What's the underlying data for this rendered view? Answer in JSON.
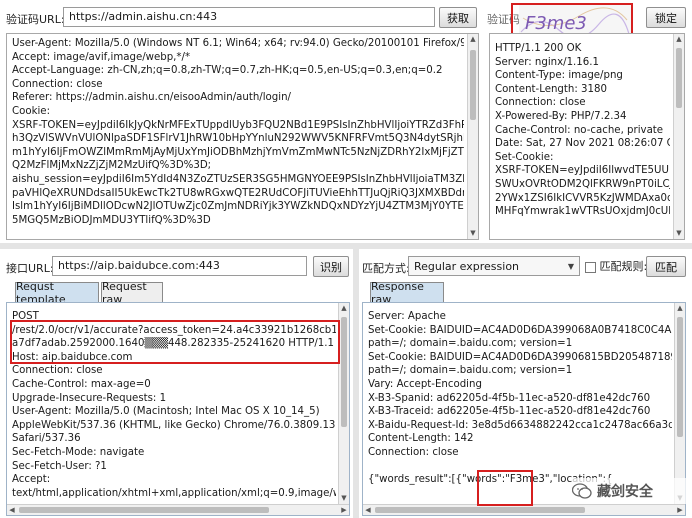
{
  "captcha_url": {
    "label": "验证码URL:",
    "value": "https://admin.aishu.cn:443",
    "fetch_button": "获取"
  },
  "captcha": {
    "label": "验证码",
    "image_text": "F3me3",
    "confirm_button": "锁定"
  },
  "request_top": {
    "lines": [
      "User-Agent: Mozilla/5.0 (Windows NT 6.1; Win64; x64; rv:94.0) Gecko/20100101 Firefox/94.0",
      "Accept: image/avif,image/webp,*/*",
      "Accept-Language: zh-CN,zh;q=0.8,zh-TW;q=0.7,zh-HK;q=0.5,en-US;q=0.3,en;q=0.2",
      "Connection: close",
      "Referer: https://admin.aishu.cn/eisooAdmin/auth/login/",
      "Cookie:",
      "XSRF-TOKEN=eyJpdiI6IkJyQkNrMFExTUppdlUyb3FQU2NBd1E9PSIsInZhbHVlIjoiYTRZd3FhRjd3Qj",
      "h3QzVlSWVnVUlONlpaSDF1SFlrV1JhRW10bHpYYnluN292WWV5KNFRFVmt5Q3N4dytSRjhlMSlsI",
      "m1hYyI6IjFmOWZlMmRmMjAyMjUxYmJiODBhMzhjYmVmZmMwNTc5NzNjZDRhY2IxMjFjZTMyZW",
      "Q2MzFlMjMxNzZjZjM2MzUifQ%3D%3D;",
      "aishu_session=eyJpdiI6Im5YdId4N3ZoZTUzSER3SG5HMGNYOEE9PSIsInZhbHVlIjoiaTM3ZkhOVG",
      "paVHlQeXRUNDdsaII5UkEwcTk2TU8wRGxwQTE2RUdCOFJiTUVieEhhTTJuQjRiQ3JXMXBDdmZNby",
      "Islm1hYyI6IjBiMDllODcwN2JlOTUwZjc0ZmJmNDRiYjk3YWZkNDQxNDYzYjU4ZTM3MjY0YTE2NE2E",
      "5MGQ5MzBiODJmMDU3YTlifQ%3D%3D"
    ]
  },
  "response_top": {
    "lines": [
      "HTTP/1.1 200 OK",
      "Server: nginx/1.16.1",
      "Content-Type: image/png",
      "Content-Length: 3180",
      "Connection: close",
      "X-Powered-By: PHP/7.2.34",
      "Cache-Control: no-cache, private",
      "Date: Sat, 27 Nov 2021 08:26:07 GMT",
      "Set-Cookie:",
      "XSRF-TOKEN=eyJpdiI6IlwvdTE5UU1H",
      "SWUxOVRtODM2QlFKRW9nPT0iLCJ",
      "2YWx1ZSI6IkICVVR5KzJWMDAxa0dr",
      "MHFqYmwrak1wVTRsUOxjdmJ0cUlH"
    ]
  },
  "api_url": {
    "label": "接口URL:",
    "value": "https://aip.baidubce.com:443",
    "identify_button": "识别"
  },
  "match": {
    "label": "匹配方式:",
    "mode": "Regular expression",
    "rule_label": "匹配规则:",
    "match_button": "匹配"
  },
  "request_tabs": {
    "template": "Requst template",
    "raw": "Request raw"
  },
  "request_template": {
    "lines": [
      "POST",
      "/rest/2.0/ocr/v1/accurate?access_token=24.a4c33921b1268cb10440",
      "a7df7adab.2592000.1640▒▒▒448.282335-25241620 HTTP/1.1",
      "Host: aip.baidubce.com",
      "Connection: close",
      "Cache-Control: max-age=0",
      "Upgrade-Insecure-Requests: 1",
      "User-Agent: Mozilla/5.0 (Macintosh; Intel Mac OS X 10_14_5)",
      "AppleWebKit/537.36 (KHTML, like Gecko) Chrome/76.0.3809.132",
      "Safari/537.36",
      "Sec-Fetch-Mode: navigate",
      "Sec-Fetch-User: ?1",
      "Accept:",
      "text/html,application/xhtml+xml,application/xml;q=0.9,image/webp,ima"
    ]
  },
  "response_tabs": {
    "raw": "Response raw"
  },
  "response_raw": {
    "lines": [
      "Server: Apache",
      "Set-Cookie: BAIDUID=AC4AD0D6DA399068A0B7418C0C4A2EBF:F",
      "path=/; domain=.baidu.com; version=1",
      "Set-Cookie: BAIDUID=AC4AD0D6DA39906815BD205487189078:FG",
      "path=/; domain=.baidu.com; version=1",
      "Vary: Accept-Encoding",
      "X-B3-Spanid: ad62205d-4f5b-11ec-a520-df81e42dc760",
      "X-B3-Traceid: ad62205e-4f5b-11ec-a520-df81e42dc760",
      "X-Baidu-Request-Id: 3e8d5d6634882242cca1c2478ac66a3d1000334",
      "Content-Length: 142",
      "Connection: close",
      "",
      "{\"words_result\":[{\"words\":\"F3me3\",\"location\":{"
    ]
  },
  "watermark": {
    "text": "藏剑安全"
  },
  "colors": {
    "highlight_red": "#d61f1f",
    "tab_active": "#cfe0ef"
  }
}
